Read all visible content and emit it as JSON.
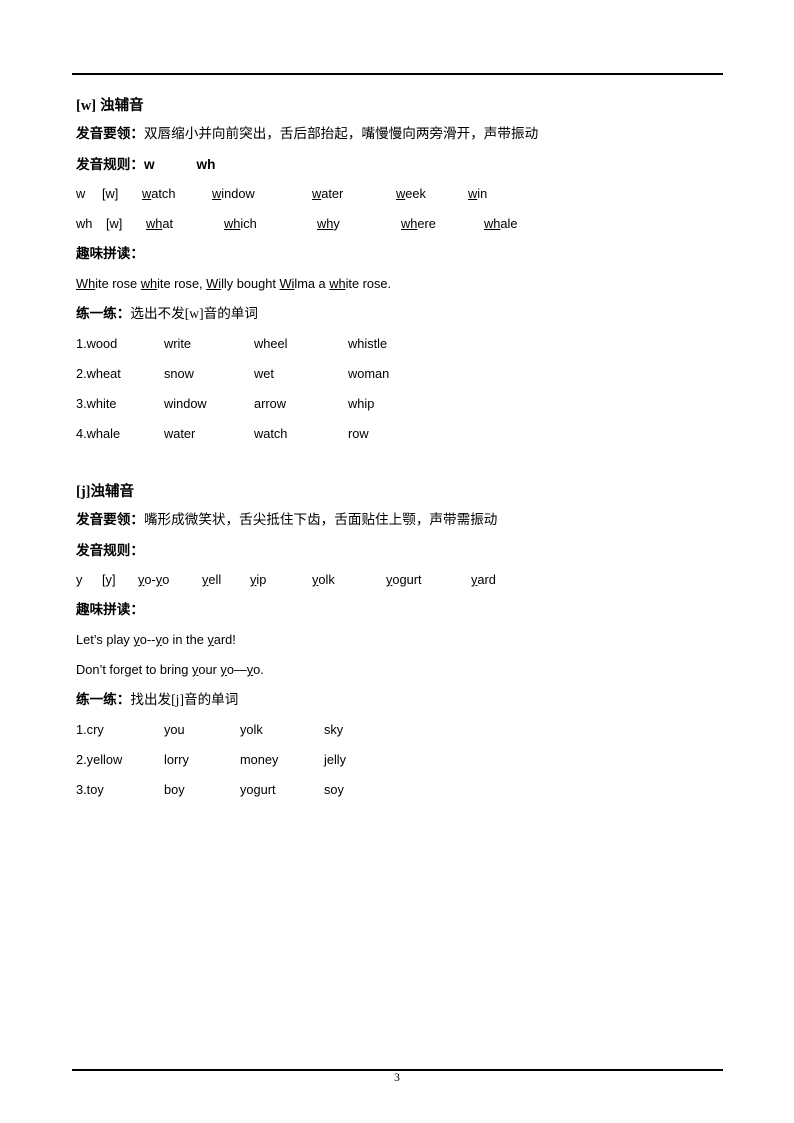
{
  "page": {
    "number": "3"
  },
  "sections": [
    {
      "heading_ipa": "[w]",
      "heading_text": " 浊辅音",
      "tips_label": "发音要领：",
      "tips_text": "双唇缩小并向前突出，舌后部抬起，嘴慢慢向两旁滑开，声带振动",
      "rules_label": "发音规则：",
      "rules_key1": "w",
      "rules_key2": "wh",
      "rule_rows": [
        {
          "letter": "w",
          "ipa": "[w]",
          "words": [
            {
              "head": "w",
              "tail": "atch"
            },
            {
              "head": "w",
              "tail": "indow"
            },
            {
              "head": "w",
              "tail": "ater"
            },
            {
              "head": "w",
              "tail": "eek"
            },
            {
              "head": "w",
              "tail": "in"
            }
          ]
        },
        {
          "letter": "wh",
          "ipa": "[w]",
          "words": [
            {
              "head": "wh",
              "tail": "at"
            },
            {
              "head": "wh",
              "tail": "ich"
            },
            {
              "head": "wh",
              "tail": "y"
            },
            {
              "head": "wh",
              "tail": "ere"
            },
            {
              "head": "wh",
              "tail": "ale"
            }
          ]
        }
      ],
      "twister_label": "趣味拼读：",
      "twister_lines": [
        [
          {
            "u": "Wh",
            "t": "ite rose "
          },
          {
            "u": "wh",
            "t": "ite rose, "
          },
          {
            "u": "Wi",
            "t": "lly bought "
          },
          {
            "u": "Wi",
            "t": "lma a "
          },
          {
            "u": "wh",
            "t": "ite rose."
          }
        ]
      ],
      "exercise_label": "练一练：",
      "exercise_text_pre": "选出不发",
      "exercise_ipa": "[w]",
      "exercise_text_post": "音的单词",
      "exercise_rows": [
        [
          "1.wood",
          "write",
          "wheel",
          "whistle"
        ],
        [
          "2.wheat",
          "snow",
          "wet",
          "woman"
        ],
        [
          "3.white",
          "window",
          "arrow",
          "whip"
        ],
        [
          "4.whale",
          "water",
          "watch",
          "row"
        ]
      ]
    },
    {
      "heading_ipa": "[j]",
      "heading_text": "浊辅音",
      "tips_label": "发音要领：",
      "tips_text": "嘴形成微笑状，舌尖抵住下齿，舌面贴住上颚，声带需振动",
      "rules_label": "发音规则：",
      "rules_key1": "",
      "rules_key2": "",
      "rule_rows": [
        {
          "letter": "y",
          "ipa": "[y]",
          "words": [
            {
              "head": "y",
              "tail": "o-",
              "head2": "y",
              "tail2": "o"
            },
            {
              "head": "y",
              "tail": "ell"
            },
            {
              "head": "y",
              "tail": "ip"
            },
            {
              "head": "y",
              "tail": "olk"
            },
            {
              "head": "y",
              "tail": "ogurt"
            },
            {
              "head": "y",
              "tail": "ard"
            }
          ]
        }
      ],
      "twister_label": "趣味拼读：",
      "twister_lines": [
        [
          {
            "u": "",
            "t": "Let’s play "
          },
          {
            "u": "y",
            "t": "o--"
          },
          {
            "u": "y",
            "t": "o in the "
          },
          {
            "u": "y",
            "t": "ard!"
          }
        ],
        [
          {
            "u": "",
            "t": "Don’t forget to bring "
          },
          {
            "u": "y",
            "t": "our "
          },
          {
            "u": "y",
            "t": "o—"
          },
          {
            "u": "y",
            "t": "o."
          }
        ]
      ],
      "exercise_label": "练一练：",
      "exercise_text_pre": "找出发",
      "exercise_ipa": "[j]",
      "exercise_text_post": "音的单词",
      "exercise_rows": [
        [
          "1.cry",
          "you",
          "yolk",
          "sky"
        ],
        [
          "2.yellow",
          "lorry",
          "money",
          "jelly"
        ],
        [
          "3.toy",
          "boy",
          "yogurt",
          "soy"
        ]
      ]
    }
  ],
  "layout": {
    "rule_row_cols": [
      0,
      26,
      66,
      136,
      236,
      326,
      396
    ],
    "rule_row_cols_w": [
      0,
      26,
      66,
      136,
      236,
      326,
      396
    ],
    "rule_row_cols_wh": [
      0,
      30,
      74,
      150,
      245,
      335,
      425
    ],
    "rule_row_cols_y": [
      0,
      26,
      62,
      126,
      172,
      235,
      310,
      395
    ],
    "exercise_cols": [
      0,
      82,
      170,
      272
    ]
  }
}
